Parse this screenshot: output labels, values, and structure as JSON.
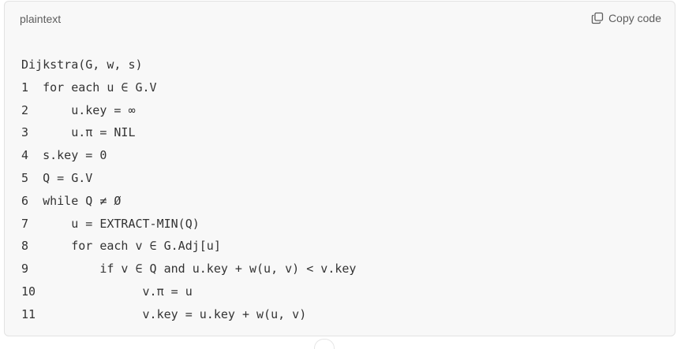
{
  "header": {
    "language": "plaintext",
    "copy_label": "Copy code",
    "copy_icon": "copy-icon"
  },
  "code": {
    "lines": [
      "Dijkstra(G, w, s)",
      "1  for each u ∈ G.V",
      "2      u.key = ∞",
      "3      u.π = NIL",
      "4  s.key = 0",
      "5  Q = G.V",
      "6  while Q ≠ Ø",
      "7      u = EXTRACT-MIN(Q)",
      "8      for each v ∈ G.Adj[u]",
      "9          if v ∈ Q and u.key + w(u, v) < v.key",
      "10               v.π = u",
      "11               v.key = u.key + w(u, v)"
    ]
  },
  "colors": {
    "block_background": "#f8f8f8",
    "text": "#333333",
    "muted_text": "#5d5d5d"
  }
}
